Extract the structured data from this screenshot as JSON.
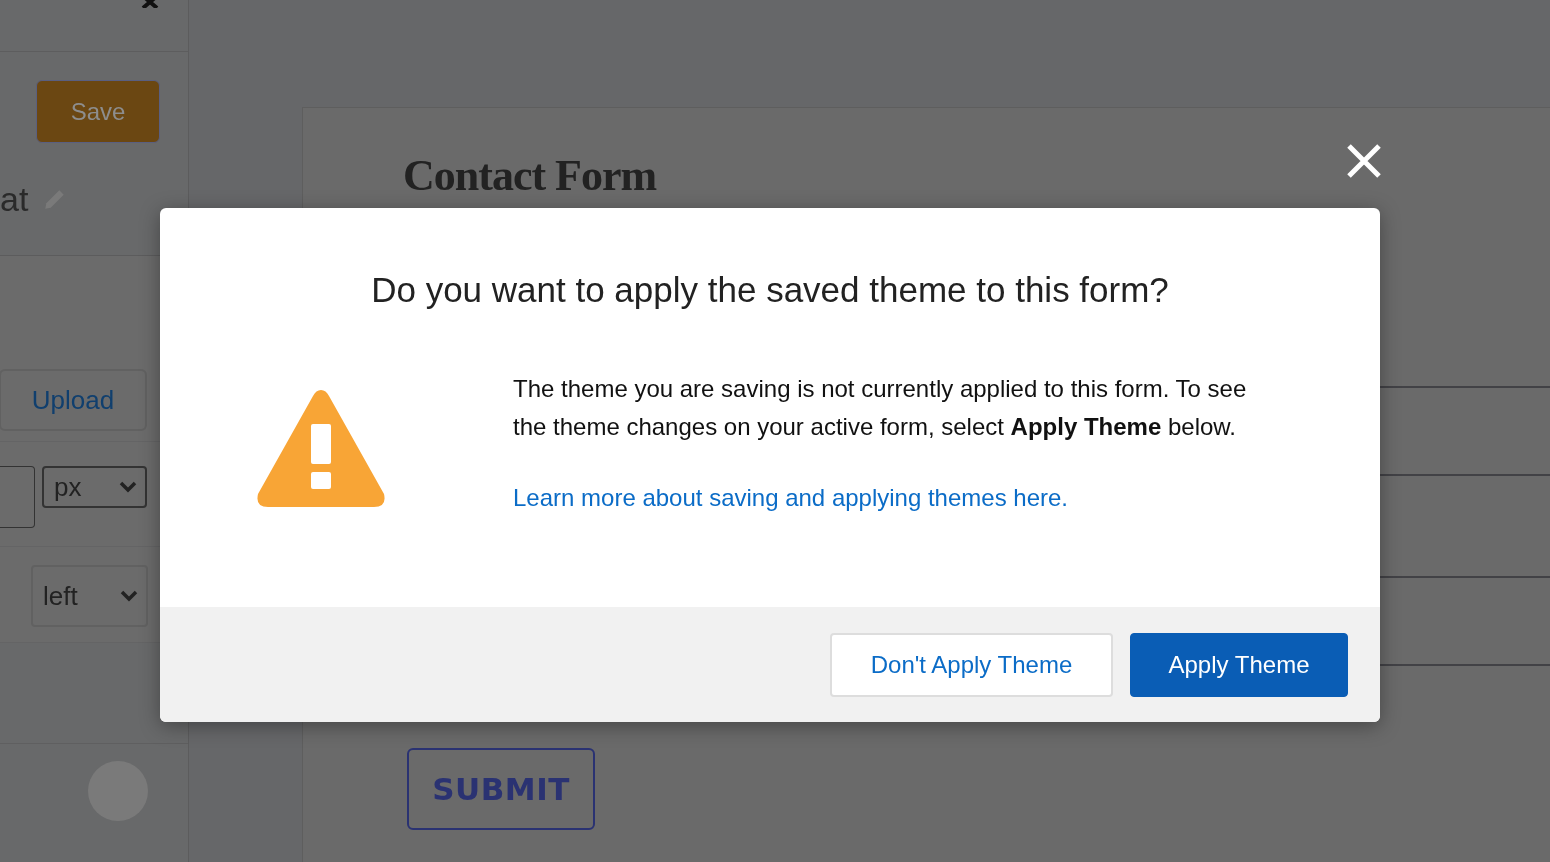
{
  "sidebar": {
    "save_button": "Save",
    "title_fragment": "at",
    "upload_button": "Upload",
    "unit_select": "px",
    "align_select": "left"
  },
  "form": {
    "title": "Contact Form",
    "submit_button": "SUBMIT"
  },
  "dialog": {
    "title": "Do you want to apply the saved theme to this form?",
    "message": "The theme you are saving is not currently applied to this form. To see the theme changes on your active form, select **Apply Theme** below.",
    "link": "Learn more about saving and applying themes here.",
    "buttons": [
      {
        "label": "Don't Apply Theme",
        "kind": "secondary"
      },
      {
        "label": "Apply Theme",
        "kind": "primary"
      }
    ]
  }
}
